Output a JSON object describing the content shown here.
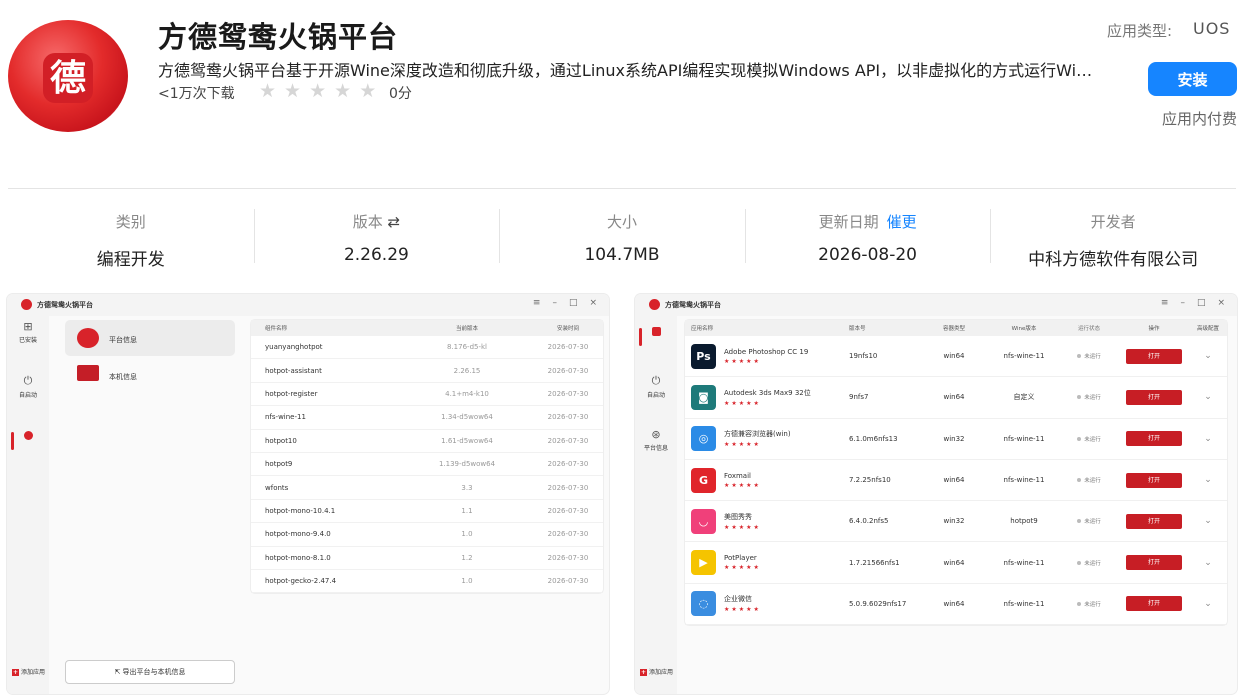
{
  "app": {
    "logo_char": "德",
    "title": "方德鸳鸯火锅平台",
    "description": "方德鸳鸯火锅平台基于开源Wine深度改造和彻底升级，通过Linux系统API编程实现模拟Windows API，以非虚拟化的方式运行Windows应用程序，为用户提供高效便捷的应用兼容体验",
    "downloads": "<1万次下载",
    "rating_stars": [
      "★",
      "★",
      "★",
      "★",
      "★"
    ],
    "rating": 0,
    "score": "0分",
    "type_label": "应用类型:",
    "type_value": "UOS",
    "install_label": "安装",
    "iap_label": "应用内付费",
    "colors": {
      "accent": "#1685ff",
      "brand": "#d8232a"
    }
  },
  "meta": {
    "category": {
      "label": "类别",
      "value": "编程开发"
    },
    "version": {
      "label": "版本",
      "icon": "⇄",
      "value": "2.26.29"
    },
    "size": {
      "label": "大小",
      "value": "104.7MB"
    },
    "updated": {
      "label": "更新日期",
      "urge": "催更",
      "value": "2026-08-20"
    },
    "developer": {
      "label": "开发者",
      "value": "中科方德软件有限公司"
    }
  },
  "screenshot1": {
    "window_title": "方德鸳鸯火锅平台",
    "controls": [
      "≡",
      "–",
      "□",
      "×"
    ],
    "sidebar": [
      {
        "label": "已安装",
        "icon": "grid-icon"
      },
      {
        "label": "自启动",
        "icon": "power-icon"
      },
      {
        "label": "平台信息",
        "icon": "info-icon"
      }
    ],
    "add_app": "添加应用",
    "nav": [
      {
        "label": "平台信息",
        "icon": "platform-icon"
      },
      {
        "label": "本机信息",
        "icon": "computer-icon"
      }
    ],
    "export_label": "导出平台与本机信息",
    "table": {
      "headers": [
        "组件名称",
        "当前版本",
        "安装时间"
      ],
      "rows": [
        {
          "name": "yuanyanghotpot",
          "version": "8.176-d5-kl",
          "date": "2026-07-30"
        },
        {
          "name": "hotpot-assistant",
          "version": "2.26.15",
          "date": "2026-07-30"
        },
        {
          "name": "hotpot-register",
          "version": "4.1+m4-k10",
          "date": "2026-07-30"
        },
        {
          "name": "nfs-wine-11",
          "version": "1.34-d5wow64",
          "date": "2026-07-30"
        },
        {
          "name": "hotpot10",
          "version": "1.61-d5wow64",
          "date": "2026-07-30"
        },
        {
          "name": "hotpot9",
          "version": "1.139-d5wow64",
          "date": "2026-07-30"
        },
        {
          "name": "wfonts",
          "version": "3.3",
          "date": "2026-07-30"
        },
        {
          "name": "hotpot-mono-10.4.1",
          "version": "1.1",
          "date": "2026-07-30"
        },
        {
          "name": "hotpot-mono-9.4.0",
          "version": "1.0",
          "date": "2026-07-30"
        },
        {
          "name": "hotpot-mono-8.1.0",
          "version": "1.2",
          "date": "2026-07-30"
        },
        {
          "name": "hotpot-gecko-2.47.4",
          "version": "1.0",
          "date": "2026-07-30"
        }
      ]
    }
  },
  "screenshot2": {
    "window_title": "方德鸳鸯火锅平台",
    "controls": [
      "≡",
      "–",
      "□",
      "×"
    ],
    "sidebar": [
      {
        "label": "",
        "icon": "apps-icon"
      },
      {
        "label": "自启动",
        "icon": "power-icon"
      },
      {
        "label": "平台信息",
        "icon": "info-icon"
      }
    ],
    "add_app": "添加应用",
    "table": {
      "headers": [
        "应用名称",
        "版本号",
        "容器类型",
        "Wine版本",
        "运行状态",
        "操作",
        "高级配置"
      ],
      "rows": [
        {
          "name": "Adobe Photoshop CC 19",
          "version": "19nfs10",
          "container": "win64",
          "wine": "nfs-wine-11",
          "status": "未运行",
          "action": "打开",
          "icon_text": "Ps",
          "icon_color": "#0a1a2e",
          "stars": "★★★★★"
        },
        {
          "name": "Autodesk 3ds Max9 32位",
          "version": "9nfs7",
          "container": "win64",
          "wine": "自定义",
          "status": "未运行",
          "action": "打开",
          "icon_text": "◙",
          "icon_color": "#1e7a7a",
          "stars": "★★★★★"
        },
        {
          "name": "方德兼容浏览器(win)",
          "version": "6.1.0m6nfs13",
          "container": "win32",
          "wine": "nfs-wine-11",
          "status": "未运行",
          "action": "打开",
          "icon_text": "◎",
          "icon_color": "#2b8be6",
          "stars": "★★★★★"
        },
        {
          "name": "Foxmail",
          "version": "7.2.25nfs10",
          "container": "win64",
          "wine": "nfs-wine-11",
          "status": "未运行",
          "action": "打开",
          "icon_text": "G",
          "icon_color": "#e0252b",
          "stars": "★★★★★"
        },
        {
          "name": "美图秀秀",
          "version": "6.4.0.2nfs5",
          "container": "win32",
          "wine": "hotpot9",
          "status": "未运行",
          "action": "打开",
          "icon_text": "◡",
          "icon_color": "#f0407a",
          "stars": "★★★★★"
        },
        {
          "name": "PotPlayer",
          "version": "1.7.21566nfs1",
          "container": "win64",
          "wine": "nfs-wine-11",
          "status": "未运行",
          "action": "打开",
          "icon_text": "▶",
          "icon_color": "#f5c400",
          "stars": "★★★★★"
        },
        {
          "name": "企业微信",
          "version": "5.0.9.6029nfs17",
          "container": "win64",
          "wine": "nfs-wine-11",
          "status": "未运行",
          "action": "打开",
          "icon_text": "◌",
          "icon_color": "#3a8de0",
          "stars": "★★★★★"
        }
      ]
    }
  }
}
